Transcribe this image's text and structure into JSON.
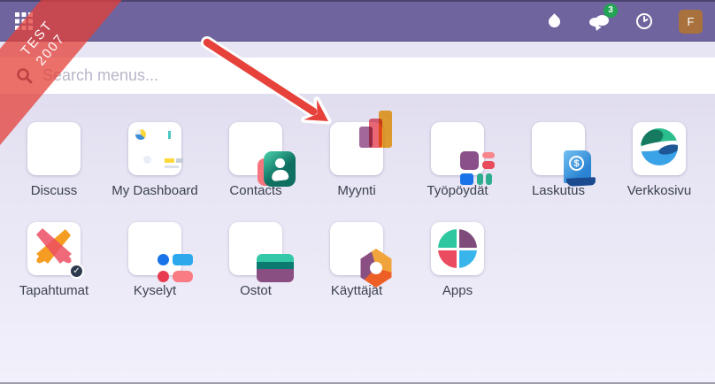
{
  "topbar": {
    "apps_menu_icon": "grid-3x3",
    "systray": {
      "droplet_icon": "droplet",
      "messages_icon": "chat-bubbles",
      "messages_badge": "3",
      "activities_icon": "clock",
      "avatar_initial": "F"
    },
    "color": "#6f649e"
  },
  "ribbon": {
    "line1": "TEST",
    "line2": "2007",
    "color": "#e43e36"
  },
  "search": {
    "placeholder": "Search menus...",
    "icon": "magnifier"
  },
  "apps": [
    {
      "id": "discuss",
      "label": "Discuss"
    },
    {
      "id": "dashboard",
      "label": "My Dashboard"
    },
    {
      "id": "contacts",
      "label": "Contacts"
    },
    {
      "id": "sales",
      "label": "Myynti"
    },
    {
      "id": "boards",
      "label": "Työpöydät"
    },
    {
      "id": "invoicing",
      "label": "Laskutus"
    },
    {
      "id": "website",
      "label": "Verkkosivu"
    },
    {
      "id": "events",
      "label": "Tapahtumat",
      "badge": "check"
    },
    {
      "id": "surveys",
      "label": "Kyselyt"
    },
    {
      "id": "purchase",
      "label": "Ostot"
    },
    {
      "id": "users",
      "label": "Käyttäjät"
    },
    {
      "id": "apps",
      "label": "Apps"
    }
  ],
  "annotation": {
    "type": "arrow",
    "color": "#e6413a",
    "points_at": "Myynti"
  }
}
